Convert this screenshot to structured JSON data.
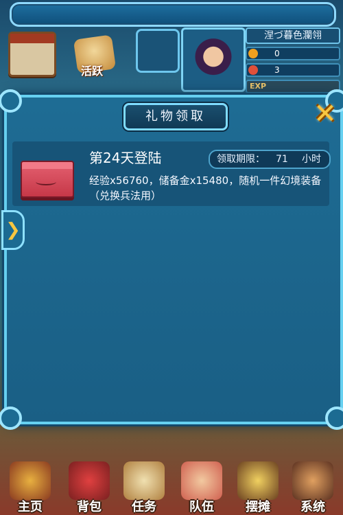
{
  "background": {
    "activity_label": "活跃",
    "player": {
      "name": "涅づ暮色瀾翎",
      "stat1_value": "0",
      "stat2_value": "3",
      "exp_label": "EXP"
    }
  },
  "modal": {
    "title": "礼物领取",
    "close_symbol": "✕",
    "gift": {
      "title": "第24天登陆",
      "deadline_label": "领取期限：",
      "deadline_value": "71",
      "deadline_unit": "小时",
      "description": "经验x56760，储备金x15480，随机一件幻境装备（兑换兵法用）"
    },
    "side_arrow": "❯"
  },
  "bottom_nav": [
    {
      "label": "主页",
      "icon": "home-pagoda-icon"
    },
    {
      "label": "背包",
      "icon": "chest-icon"
    },
    {
      "label": "任务",
      "icon": "scroll-icon"
    },
    {
      "label": "队伍",
      "icon": "team-icon"
    },
    {
      "label": "摆摊",
      "icon": "stall-icon"
    },
    {
      "label": "系统",
      "icon": "gear-icon"
    }
  ]
}
